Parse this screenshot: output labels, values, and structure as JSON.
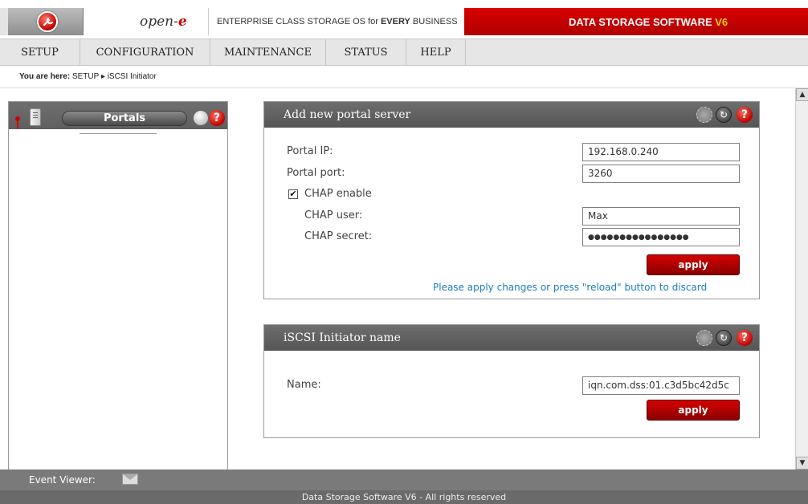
{
  "header": {
    "brand": "open-",
    "brand_e": "e",
    "tagline_prefix": "ENTERPRISE CLASS STORAGE OS for ",
    "tagline_bold": "EVERY",
    "tagline_suffix": " BUSINESS",
    "product": "DATA STORAGE SOFTWARE ",
    "product_version": "V6",
    "accent_color": "#c00000"
  },
  "nav": {
    "items": [
      {
        "label": "SETUP"
      },
      {
        "label": "CONFIGURATION"
      },
      {
        "label": "MAINTENANCE"
      },
      {
        "label": "STATUS"
      },
      {
        "label": "HELP"
      }
    ]
  },
  "breadcrumb": {
    "prefix": "You are here:",
    "path": "SETUP ▸ iSCSI Initiator"
  },
  "left_panel": {
    "tab_label": "Portals",
    "icons": [
      "server-icon",
      "tools-icon",
      "help-icon"
    ]
  },
  "portal_box": {
    "title": "Add new portal server",
    "portal_ip_label": "Portal IP:",
    "portal_ip_value": "192.168.0.240",
    "portal_port_label": "Portal port:",
    "portal_port_value": "3260",
    "chap_enable_label": "CHAP enable",
    "chap_enable_checked": "✔",
    "chap_user_label": "CHAP user:",
    "chap_user_value": "Max",
    "chap_secret_label": "CHAP secret:",
    "chap_secret_value": "●●●●●●●●●●●●●●●●",
    "apply_label": "apply",
    "note": "Please apply changes or press \"reload\" button to discard"
  },
  "initiator_box": {
    "title": "iSCSI Initiator name",
    "name_label": "Name:",
    "name_value": "iqn.com.dss:01.c3d5bc42d5c",
    "apply_label": "apply"
  },
  "footer": {
    "event_viewer": "Event Viewer:",
    "copyright": "Data Storage Software V6 - All rights reserved"
  }
}
